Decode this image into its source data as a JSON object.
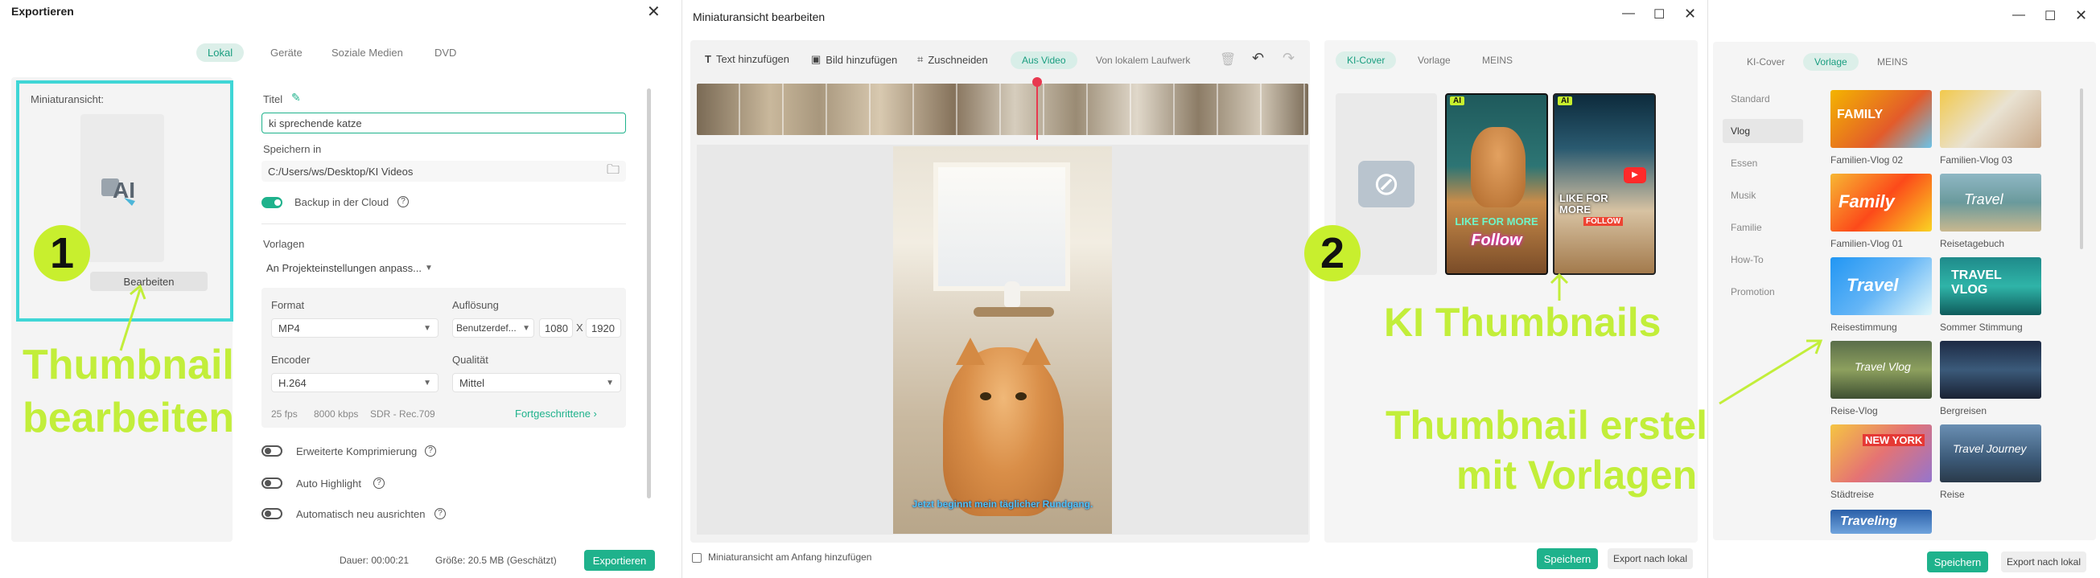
{
  "export_dialog": {
    "title": "Exportieren",
    "tabs": [
      "Lokal",
      "Geräte",
      "Soziale Medien",
      "DVD"
    ],
    "thumbnail_label": "Miniaturansicht:",
    "edit_button": "Bearbeiten",
    "title_label": "Titel",
    "title_value": "ki sprechende katze",
    "save_in_label": "Speichern in",
    "save_path": "C:/Users/ws/Desktop/KI Videos",
    "backup_label": "Backup in der Cloud",
    "presets_label": "Vorlagen",
    "preset_value": "An Projekteinstellungen anpass...",
    "format_label": "Format",
    "format_value": "MP4",
    "resolution_label": "Auflösung",
    "resolution_value": "Benutzerdef...",
    "res_w": "1080",
    "res_x": "X",
    "res_h": "1920",
    "encoder_label": "Encoder",
    "encoder_value": "H.264",
    "quality_label": "Qualität",
    "quality_value": "Mittel",
    "specs": [
      "25 fps",
      "8000 kbps",
      "SDR - Rec.709"
    ],
    "advanced_link": "Fortgeschrittene",
    "opt_compress": "Erweiterte Komprimierung",
    "opt_highlight": "Auto Highlight",
    "opt_realign": "Automatisch neu ausrichten",
    "duration": "Dauer: 00:00:21",
    "size": "Größe: 20.5 MB (Geschätzt)",
    "export_button": "Exportieren"
  },
  "annotations": {
    "num1": "1",
    "label1_line1": "Thumbnail",
    "label1_line2": "bearbeiten",
    "num2": "2",
    "label2": "KI Thumbnails",
    "label3_line1": "Thumbnail erstellen",
    "label3_line2": "mit Vorlagen"
  },
  "thumb_editor": {
    "title": "Miniaturansicht bearbeiten",
    "toolbar": [
      "Text hinzufügen",
      "Bild hinzufügen",
      "Zuschneiden"
    ],
    "source_tabs": [
      "Aus Video",
      "Von lokalem Laufwerk"
    ],
    "subtitle": "Jetzt beginnt mein täglicher Rundgang.",
    "checkbox_label": "Miniaturansicht am Anfang hinzufügen",
    "right_tabs": [
      "KI-Cover",
      "Vorlage",
      "MEINS"
    ],
    "ai_badge": "AI",
    "card1_text1": "LIKE FOR MORE",
    "card1_text2": "Follow",
    "card2_text1": "LIKE FOR MORE",
    "card2_text2": "FOLLOW",
    "save_button": "Speichern",
    "export_button": "Export nach lokal"
  },
  "template_panel": {
    "tabs": [
      "KI-Cover",
      "Vorlage",
      "MEINS"
    ],
    "categories": [
      "Standard",
      "Vlog",
      "Essen",
      "Musik",
      "Familie",
      "How-To",
      "Promotion"
    ],
    "templates": [
      {
        "name": "Familien-Vlog 02",
        "art": "FAMILY"
      },
      {
        "name": "Familien-Vlog 03",
        "art": ""
      },
      {
        "name": "Familien-Vlog 01",
        "art": "Family"
      },
      {
        "name": "Reisetagebuch",
        "art": "Travel"
      },
      {
        "name": "Reisestimmung",
        "art": "Travel"
      },
      {
        "name": "Sommer Stimmung",
        "art": "TRAVEL VLOG"
      },
      {
        "name": "Reise-Vlog",
        "art": "Travel Vlog"
      },
      {
        "name": "Bergreisen",
        "art": ""
      },
      {
        "name": "Städtreise",
        "art": "NEW YORK"
      },
      {
        "name": "Reise",
        "art": "Travel Journey"
      },
      {
        "name": "",
        "art": "Traveling"
      }
    ],
    "save_button": "Speichern",
    "export_button": "Export nach lokal"
  },
  "colors": {
    "accent": "#1fb28c",
    "annotation": "#c2ee3a",
    "highlight_border": "#3fd6d6"
  }
}
